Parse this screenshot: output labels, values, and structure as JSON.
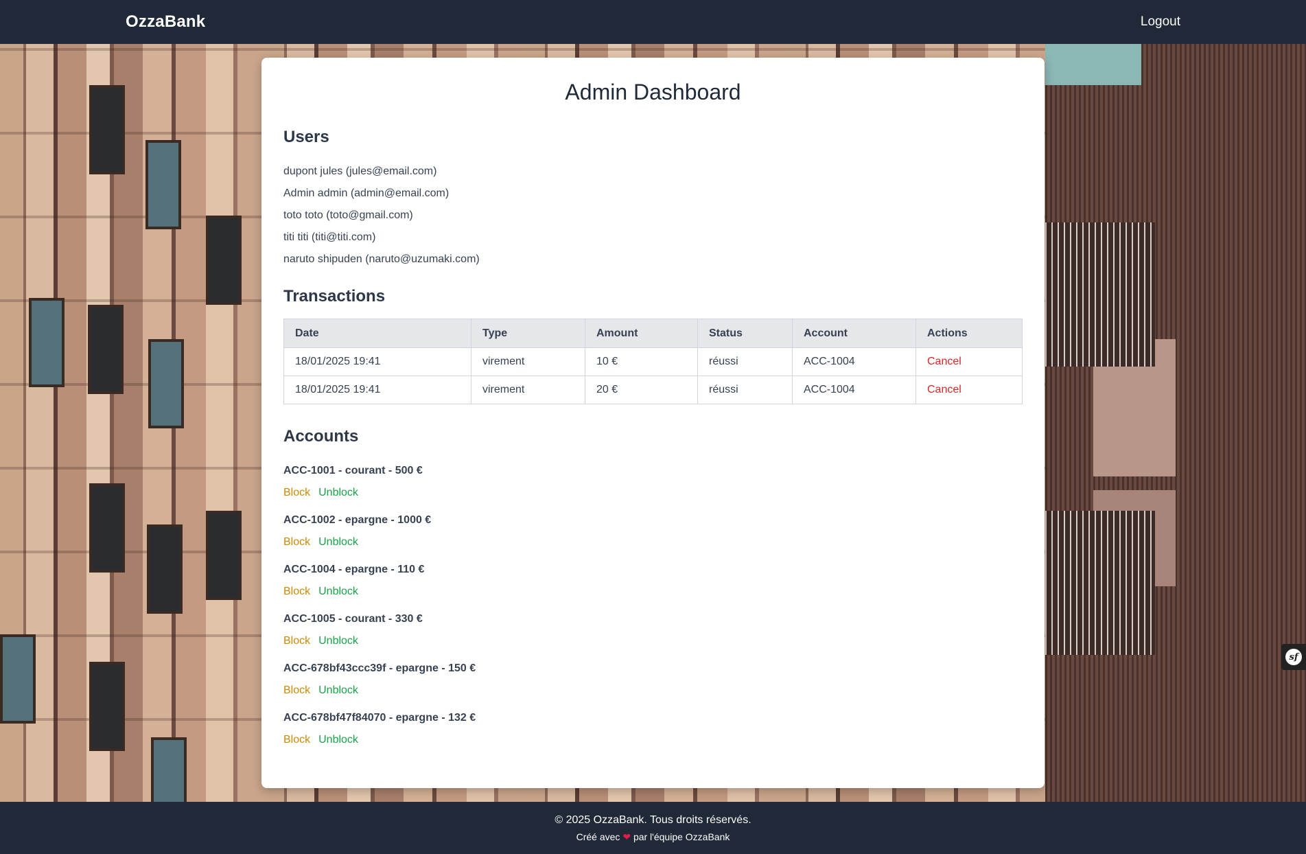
{
  "header": {
    "brand": "OzzaBank",
    "logout_label": "Logout"
  },
  "page": {
    "title": "Admin Dashboard"
  },
  "users": {
    "heading": "Users",
    "items": [
      "dupont jules (jules@email.com)",
      "Admin admin (admin@email.com)",
      "toto toto (toto@gmail.com)",
      "titi titi (titi@titi.com)",
      "naruto shipuden (naruto@uzumaki.com)"
    ]
  },
  "transactions": {
    "heading": "Transactions",
    "columns": [
      "Date",
      "Type",
      "Amount",
      "Status",
      "Account",
      "Actions"
    ],
    "rows": [
      {
        "date": "18/01/2025 19:41",
        "type": "virement",
        "amount": "10 €",
        "status": "réussi",
        "account": "ACC-1004",
        "action": "Cancel"
      },
      {
        "date": "18/01/2025 19:41",
        "type": "virement",
        "amount": "20 €",
        "status": "réussi",
        "account": "ACC-1004",
        "action": "Cancel"
      }
    ]
  },
  "accounts": {
    "heading": "Accounts",
    "block_label": "Block",
    "unblock_label": "Unblock",
    "items": [
      "ACC-1001 - courant - 500 €",
      "ACC-1002 - epargne - 1000 €",
      "ACC-1004 - epargne - 110 €",
      "ACC-1005 - courant - 330 €",
      "ACC-678bf43ccc39f - epargne - 150 €",
      "ACC-678bf47f84070 - epargne - 132 €"
    ]
  },
  "footer": {
    "copyright": "© 2025 OzzaBank. Tous droits réservés.",
    "made_prefix": "Créé avec",
    "heart": "❤",
    "made_suffix": "par l'équipe OzzaBank"
  },
  "toolbar": {
    "symfony_glyph": "sf"
  },
  "colors": {
    "nav_bg": "#1f2937",
    "cancel": "#dc2626",
    "block": "#ca8a04",
    "unblock": "#16a34a"
  }
}
